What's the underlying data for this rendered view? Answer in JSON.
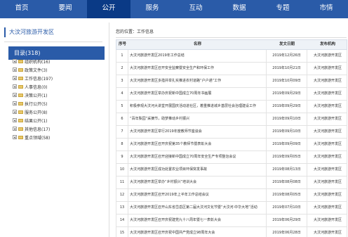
{
  "nav": {
    "items": [
      "首页",
      "要闻",
      "公开",
      "服务",
      "互动",
      "数据",
      "专题",
      "市情"
    ],
    "active_index": 2,
    "colors": {
      "bar": "#2a5ba8",
      "active": "#0a3a86"
    }
  },
  "sidebar": {
    "title": "大汶河旅游开发区",
    "directory_label": "目录(318)",
    "items": [
      "组织机构(16)",
      "政策文件(3)",
      "工作信息(197)",
      "人事信息(0)",
      "决策公开(1)",
      "执行公开(5)",
      "服务公开(8)",
      "结果公开(1)",
      "其他信息(17)",
      "重点领域(58)"
    ]
  },
  "main": {
    "breadcrumb": "您的位置：工作信息",
    "columns": [
      "序号",
      "名称",
      "发文日期",
      "发布机构"
    ],
    "rows": [
      {
        "no": "1",
        "title": "大汶河旅游开发区2019年工作总结",
        "date": "2019年12月26日",
        "org": "大汶河旅游开发区"
      },
      {
        "no": "2",
        "title": "大汶河旅游开发区召开安全监察暨安全生产和环保工作",
        "date": "2019年10月21日",
        "org": "大汶河旅游开发区"
      },
      {
        "no": "3",
        "title": "大汶河旅游开发区多措并举扎实推进农村道路“户户通”工作",
        "date": "2019年10月09日",
        "org": "大汶河旅游开发区"
      },
      {
        "no": "4",
        "title": "大汶河旅游开发区举办庆祝新中国成立70周年书画展",
        "date": "2019年09月29日",
        "org": "大汶河旅游开发区"
      },
      {
        "no": "5",
        "title": "积极参观大汶河大讲堂开展国庆活动进社区，着重推进城乡基层社会治理建设工作",
        "date": "2019年09月29日",
        "org": "大汶河旅游开发区"
      },
      {
        "no": "6",
        "title": "“百年梨园”采摘节，助梦推动乡村振兴",
        "date": "2019年09月10日",
        "org": "大汶河旅游开发区"
      },
      {
        "no": "7",
        "title": "大汶河旅游开发区举行2019年度教师节座谈会",
        "date": "2019年09月10日",
        "org": "大汶河旅游开发区"
      },
      {
        "no": "8",
        "title": "大汶河旅游开发区召开庆祝第35个教师节暨表彰大会",
        "date": "2019年09月09日",
        "org": "大汶河旅游开发区"
      },
      {
        "no": "9",
        "title": "大汶河旅游开发区召开迎接新中国成立70周年安全生产专项整治会议",
        "date": "2019年09月05日",
        "org": "大汶河旅游开发区"
      },
      {
        "no": "10",
        "title": "大汶河旅游开发区成功处置农业项目环保突发事故",
        "date": "2019年08月13日",
        "org": "大汶河旅游开发区"
      },
      {
        "no": "11",
        "title": "大汶河旅游开发区举办“乡村振兴”培训大会",
        "date": "2019年08月08日",
        "org": "大汶河旅游开发区"
      },
      {
        "no": "12",
        "title": "大汶河旅游开发区召开2019年上半年工作总结会议",
        "date": "2019年08月05日",
        "org": "大汶河旅游开发区"
      },
      {
        "no": "13",
        "title": "大汶河旅游开发区召开山东省岱岳区第二届大汶河文化节暨“大汶河·中华大地”活动",
        "date": "2019年07月10日",
        "org": "大汶河旅游开发区"
      },
      {
        "no": "14",
        "title": "大汶河旅游开发区召开庆祝建党九十八周年暨七一表彰大会",
        "date": "2019年06月29日",
        "org": "大汶河旅游开发区"
      },
      {
        "no": "15",
        "title": "大汶河旅游开发区召开庆祝中国共产党成立98周年大会",
        "date": "2019年06月28日",
        "org": "大汶河旅游开发区"
      }
    ]
  }
}
